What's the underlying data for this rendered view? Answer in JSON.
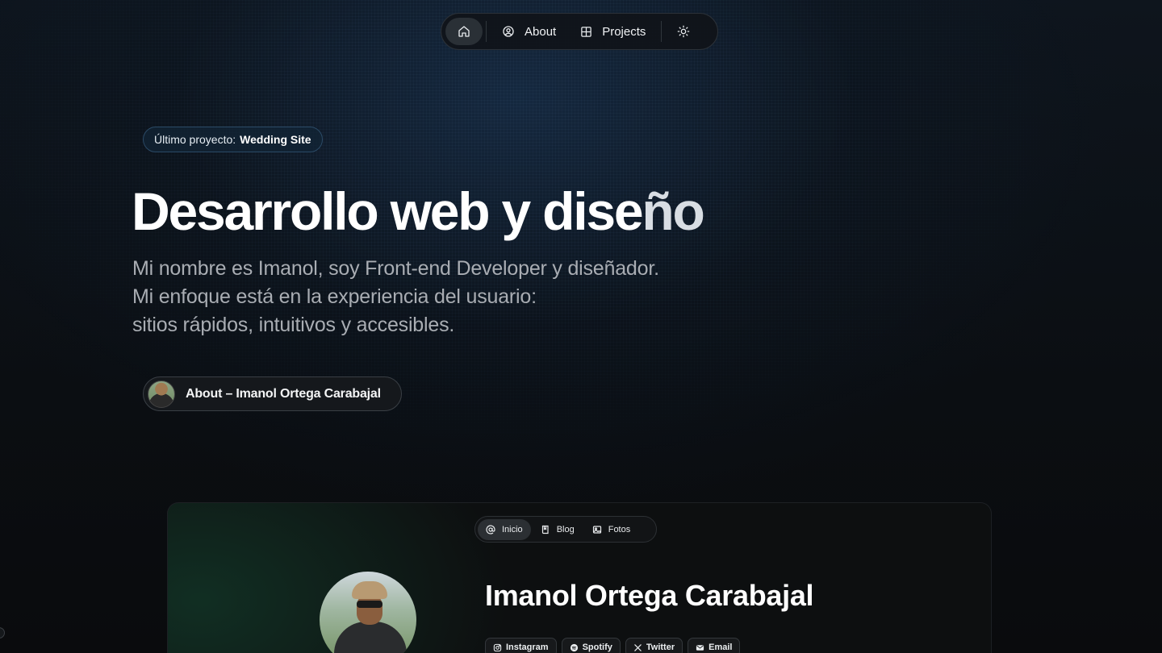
{
  "nav": {
    "home_icon": "home-icon",
    "about_label": "About",
    "about_icon": "user-circle-icon",
    "projects_label": "Projects",
    "projects_icon": "grid-icon",
    "theme_icon": "sun-icon"
  },
  "hero": {
    "badge_prefix": "Último proyecto:",
    "badge_project": "Wedding Site",
    "title_main": "Desarrollo web y dise",
    "title_tail": "ño",
    "lines": [
      "Mi nombre es Imanol, soy Front-end Developer y diseñador.",
      "Mi enfoque está en la experiencia del usuario:",
      "sitios rápidos, intuitivos y accesibles."
    ],
    "about_link_label": "About – Imanol Ortega Carabajal"
  },
  "preview": {
    "tabs": [
      {
        "label": "Inicio",
        "icon": "at-sign-icon"
      },
      {
        "label": "Blog",
        "icon": "book-icon"
      },
      {
        "label": "Fotos",
        "icon": "image-icon"
      }
    ],
    "name": "Imanol Ortega Carabajal",
    "socials": [
      {
        "label": "Instagram",
        "icon": "instagram-icon"
      },
      {
        "label": "Spotify",
        "icon": "spotify-icon"
      },
      {
        "label": "Twitter",
        "icon": "x-icon"
      },
      {
        "label": "Email",
        "icon": "mail-icon"
      }
    ]
  },
  "colors": {
    "background": "#0a0c0f",
    "badge_border": "#2b4a66",
    "text_muted": "#a9adb3"
  }
}
